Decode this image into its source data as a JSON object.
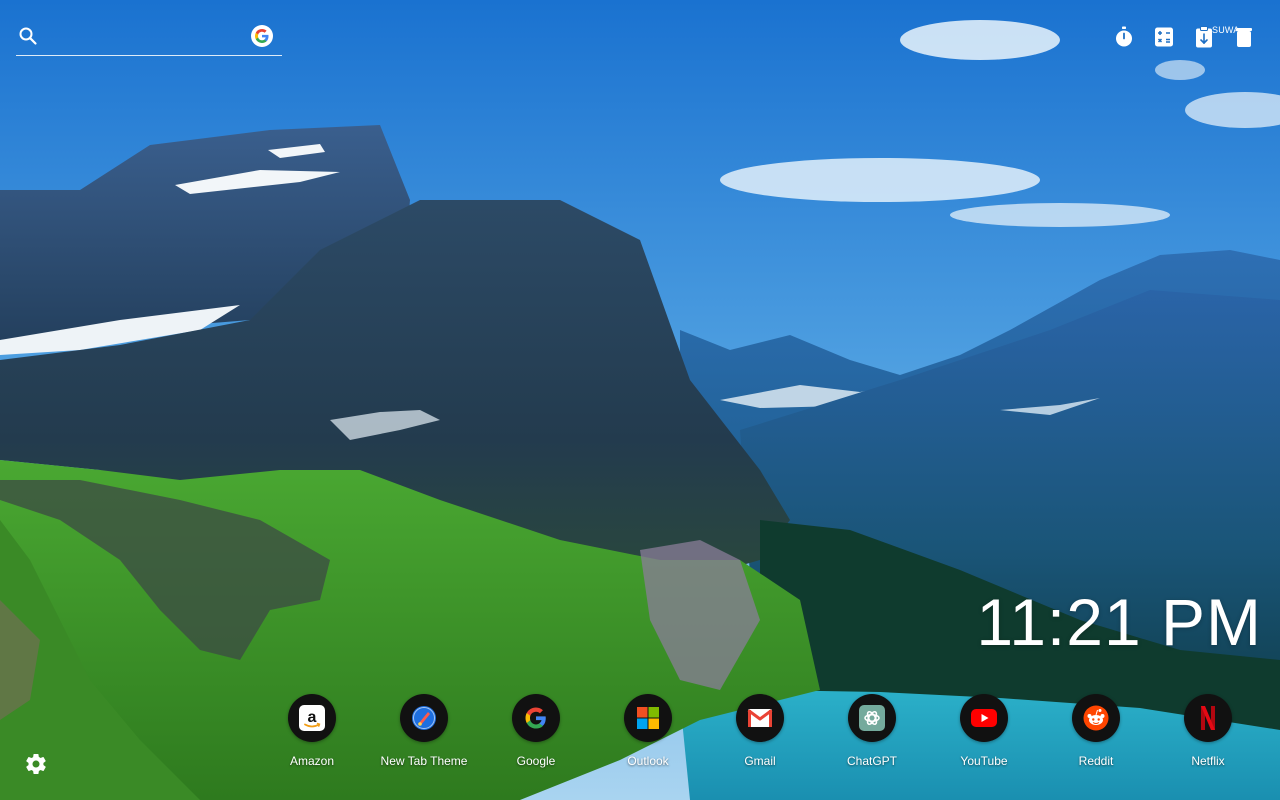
{
  "search": {
    "placeholder": "",
    "engine_icon": "google-g-icon"
  },
  "tools": [
    {
      "name": "timer-icon"
    },
    {
      "name": "calculator-icon"
    },
    {
      "name": "clipboard-icon"
    },
    {
      "name": "note-icon"
    }
  ],
  "tools_label": "SUWA",
  "clock": {
    "time": "11:21 PM"
  },
  "shortcuts": [
    {
      "label": "Amazon",
      "icon": "amazon-icon"
    },
    {
      "label": "New Tab Theme",
      "icon": "new-tab-theme-icon"
    },
    {
      "label": "Google",
      "icon": "google-icon"
    },
    {
      "label": "Outlook",
      "icon": "outlook-icon"
    },
    {
      "label": "Gmail",
      "icon": "gmail-icon"
    },
    {
      "label": "ChatGPT",
      "icon": "chatgpt-icon"
    },
    {
      "label": "YouTube",
      "icon": "youtube-icon"
    },
    {
      "label": "Reddit",
      "icon": "reddit-icon"
    },
    {
      "label": "Netflix",
      "icon": "netflix-icon"
    }
  ],
  "settings": {
    "icon": "gear-icon"
  },
  "colors": {
    "sky_top": "#1e7bd8",
    "sky_bottom": "#8cc4ee",
    "lake": "#1fa0c0",
    "grass": "#3f9a2c",
    "dock_circle": "#111111"
  }
}
